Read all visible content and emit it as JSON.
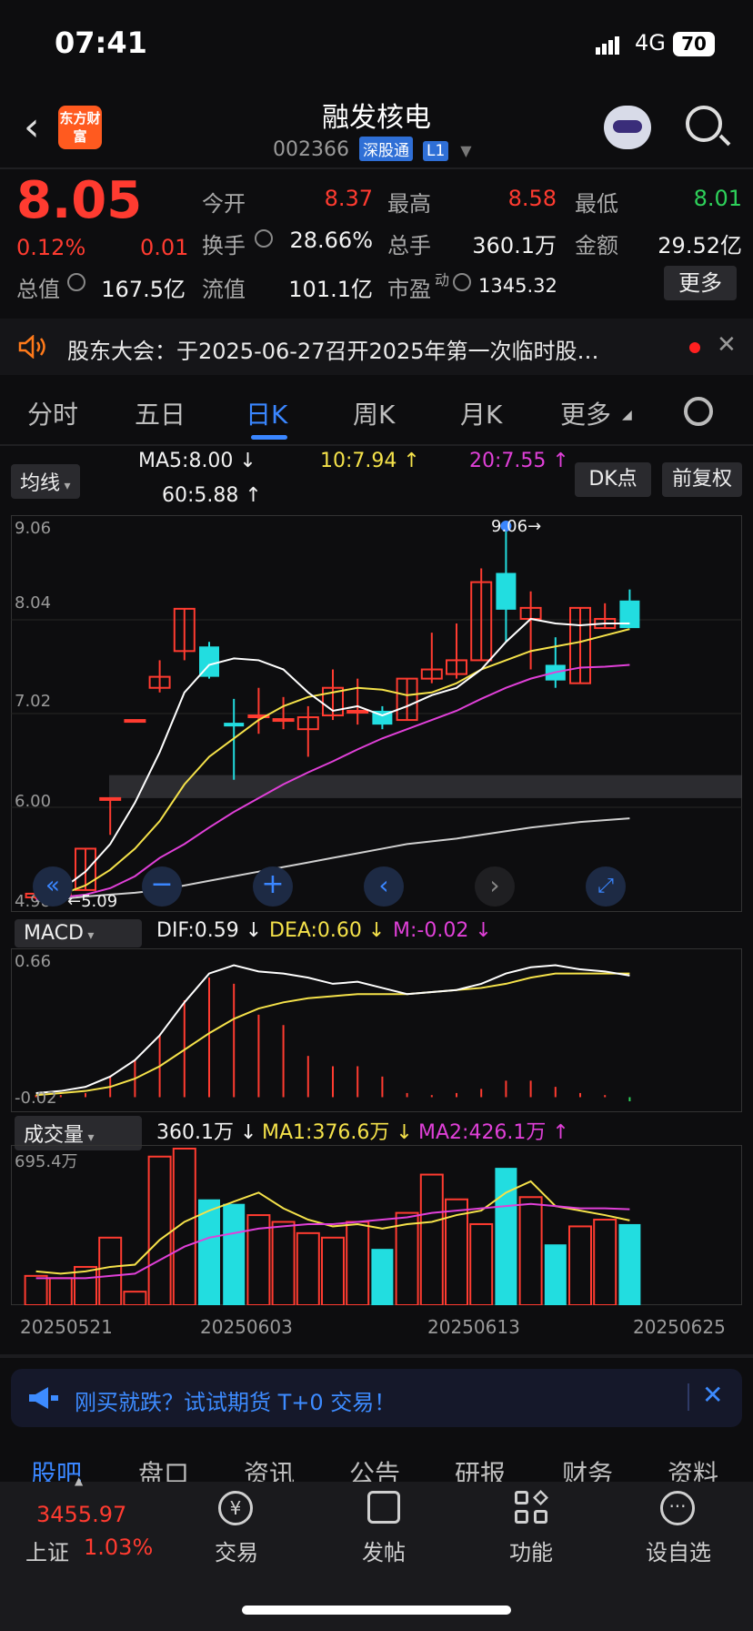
{
  "status": {
    "time": "07:41",
    "network": "4G",
    "battery": "70"
  },
  "header": {
    "title": "融发核电",
    "code": "002366",
    "tag1": "深股通",
    "tag2": "L1",
    "logo_text": "东方财富"
  },
  "quote": {
    "price": "8.05",
    "pct": "0.12%",
    "change": "0.01",
    "open_label": "今开",
    "open": "8.37",
    "high_label": "最高",
    "high": "8.58",
    "low_label": "最低",
    "low": "8.01",
    "turnover_label": "换手",
    "turnover": "28.66%",
    "volume_label": "总手",
    "volume": "360.1万",
    "amount_label": "金额",
    "amount": "29.52亿",
    "mktcap_label": "总值",
    "mktcap": "167.5亿",
    "float_label": "流值",
    "float": "101.1亿",
    "pe_label": "市盈",
    "pe_sup": "动",
    "pe": "1345.32",
    "more": "更多"
  },
  "notice": {
    "text": "股东大会：于2025-06-27召开2025年第一次临时股…"
  },
  "tabs": [
    "分时",
    "五日",
    "日K",
    "周K",
    "月K",
    "更多"
  ],
  "active_tab": 2,
  "kline": {
    "ma_button": "均线",
    "ma5": "MA5:8.00",
    "ma10": "10:7.94",
    "ma20": "20:7.55",
    "ma60": "60:5.88",
    "dk_button": "DK点",
    "fq_button": "前复权",
    "y_labels": [
      "9.06",
      "8.04",
      "7.02",
      "6.00",
      "4.98"
    ],
    "high_marker": "9.06",
    "low_marker": "5.09"
  },
  "macd": {
    "button": "MACD",
    "dif": "DIF:0.59",
    "dea": "DEA:0.60",
    "m": "M:-0.02",
    "y_top": "0.66",
    "y_bottom": "-0.02"
  },
  "vol": {
    "button": "成交量",
    "value": "360.1万",
    "ma1": "MA1:376.6万",
    "ma2": "MA2:426.1万",
    "y_top": "695.4万",
    "x_labels": [
      "20250521",
      "20250603",
      "20250613",
      "20250625"
    ]
  },
  "promo": {
    "text": "刚买就跌？试试期货 T+0 交易！"
  },
  "subtabs": [
    "股吧",
    "盘口",
    "资讯",
    "公告",
    "研报",
    "财务",
    "资料"
  ],
  "bottom": {
    "index_value": "3455.97",
    "index_name": "上证",
    "index_pct": "1.03%",
    "nav": [
      "交易",
      "发帖",
      "功能",
      "设自选"
    ]
  },
  "colors": {
    "up": "#ff3b30",
    "down": "#22dde0",
    "accent": "#3a86ff"
  },
  "chart_data": {
    "type": "candlestick",
    "y_axis_range": [
      4.98,
      9.06
    ],
    "candles": [
      {
        "o": 5.02,
        "c": 5.06,
        "h": 5.08,
        "l": 5.0
      },
      {
        "o": 5.05,
        "c": 5.1,
        "h": 5.12,
        "l": 5.01
      },
      {
        "o": 5.1,
        "c": 5.55,
        "h": 5.55,
        "l": 5.1
      },
      {
        "o": 6.1,
        "c": 6.1,
        "h": 6.1,
        "l": 5.7
      },
      {
        "o": 6.95,
        "c": 6.95,
        "h": 6.95,
        "l": 6.95
      },
      {
        "o": 7.3,
        "c": 7.42,
        "h": 7.6,
        "l": 7.25
      },
      {
        "o": 7.7,
        "c": 8.16,
        "h": 8.16,
        "l": 7.6
      },
      {
        "o": 7.75,
        "c": 7.42,
        "h": 7.8,
        "l": 7.4
      },
      {
        "o": 6.92,
        "c": 6.88,
        "h": 7.18,
        "l": 6.3
      },
      {
        "o": 7.0,
        "c": 7.0,
        "h": 7.3,
        "l": 6.8
      },
      {
        "o": 6.95,
        "c": 6.96,
        "h": 7.2,
        "l": 6.85
      },
      {
        "o": 6.85,
        "c": 6.98,
        "h": 7.1,
        "l": 6.55
      },
      {
        "o": 7.0,
        "c": 7.3,
        "h": 7.5,
        "l": 6.95
      },
      {
        "o": 7.05,
        "c": 7.05,
        "h": 7.4,
        "l": 6.9
      },
      {
        "o": 7.05,
        "c": 6.9,
        "h": 7.1,
        "l": 6.85
      },
      {
        "o": 6.95,
        "c": 7.4,
        "h": 7.4,
        "l": 6.95
      },
      {
        "o": 7.4,
        "c": 7.5,
        "h": 7.9,
        "l": 7.35
      },
      {
        "o": 7.45,
        "c": 7.6,
        "h": 8.0,
        "l": 7.4
      },
      {
        "o": 7.6,
        "c": 8.45,
        "h": 8.6,
        "l": 7.6
      },
      {
        "o": 8.55,
        "c": 8.15,
        "h": 9.06,
        "l": 7.8
      },
      {
        "o": 8.05,
        "c": 8.17,
        "h": 8.35,
        "l": 7.5
      },
      {
        "o": 7.55,
        "c": 7.38,
        "h": 7.85,
        "l": 7.3
      },
      {
        "o": 7.35,
        "c": 8.17,
        "h": 8.17,
        "l": 7.35
      },
      {
        "o": 7.95,
        "c": 8.05,
        "h": 8.22,
        "l": 7.95
      },
      {
        "o": 8.25,
        "c": 7.95,
        "h": 8.37,
        "l": 7.95
      }
    ],
    "ma5": [
      5.05,
      5.1,
      5.3,
      5.6,
      6.05,
      6.6,
      7.25,
      7.55,
      7.62,
      7.6,
      7.5,
      7.25,
      7.05,
      7.1,
      7.0,
      7.1,
      7.22,
      7.3,
      7.5,
      7.8,
      8.05,
      8.0,
      7.98,
      8.0,
      8.0
    ],
    "ma10": [
      5.02,
      5.05,
      5.15,
      5.32,
      5.55,
      5.85,
      6.25,
      6.55,
      6.75,
      6.95,
      7.1,
      7.2,
      7.25,
      7.3,
      7.28,
      7.22,
      7.25,
      7.35,
      7.5,
      7.6,
      7.7,
      7.75,
      7.8,
      7.87,
      7.94
    ],
    "ma20": [
      5.0,
      5.02,
      5.05,
      5.12,
      5.25,
      5.45,
      5.6,
      5.78,
      5.95,
      6.1,
      6.25,
      6.38,
      6.5,
      6.63,
      6.75,
      6.85,
      6.95,
      7.05,
      7.18,
      7.3,
      7.4,
      7.47,
      7.52,
      7.53,
      7.55
    ],
    "ma60": [
      4.98,
      5.0,
      5.03,
      5.05,
      5.07,
      5.1,
      5.15,
      5.2,
      5.25,
      5.3,
      5.35,
      5.4,
      5.45,
      5.5,
      5.55,
      5.6,
      5.63,
      5.66,
      5.7,
      5.74,
      5.78,
      5.81,
      5.84,
      5.86,
      5.88
    ],
    "macd_dif": [
      0.02,
      0.03,
      0.05,
      0.1,
      0.18,
      0.3,
      0.46,
      0.6,
      0.64,
      0.61,
      0.6,
      0.58,
      0.55,
      0.56,
      0.53,
      0.5,
      0.51,
      0.52,
      0.55,
      0.6,
      0.63,
      0.64,
      0.62,
      0.61,
      0.59
    ],
    "macd_dea": [
      0.01,
      0.02,
      0.03,
      0.05,
      0.09,
      0.15,
      0.23,
      0.31,
      0.38,
      0.43,
      0.46,
      0.48,
      0.49,
      0.5,
      0.5,
      0.5,
      0.51,
      0.52,
      0.53,
      0.55,
      0.58,
      0.6,
      0.6,
      0.6,
      0.6
    ],
    "macd_m": [
      0.01,
      0.01,
      0.02,
      0.1,
      0.18,
      0.3,
      0.47,
      0.58,
      0.55,
      0.4,
      0.35,
      0.2,
      0.15,
      0.15,
      0.1,
      0.02,
      0.01,
      0.02,
      0.04,
      0.08,
      0.08,
      0.05,
      0.02,
      0.01,
      -0.02
    ],
    "volume": [
      130,
      120,
      170,
      300,
      60,
      660,
      695.4,
      470,
      450,
      400,
      370,
      320,
      300,
      370,
      250,
      410,
      580,
      470,
      360,
      610,
      480,
      270,
      350,
      380,
      360.1
    ],
    "vol_ma1": [
      150,
      140,
      150,
      170,
      180,
      290,
      370,
      420,
      460,
      500,
      430,
      380,
      350,
      360,
      340,
      360,
      370,
      400,
      420,
      500,
      550,
      440,
      420,
      400,
      376.6
    ],
    "vol_ma2": [
      120,
      120,
      120,
      130,
      140,
      200,
      260,
      300,
      320,
      340,
      350,
      360,
      360,
      370,
      380,
      390,
      410,
      420,
      430,
      440,
      450,
      440,
      430,
      430,
      426.1
    ]
  }
}
